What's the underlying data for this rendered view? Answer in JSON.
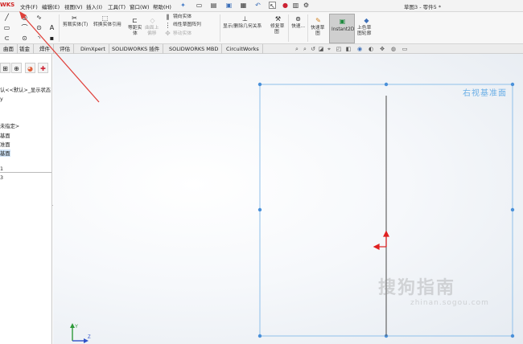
{
  "app": {
    "logo": "WKS",
    "doc_title": "草图3 - 零件5 *"
  },
  "menu": [
    "文件(F)",
    "编辑(E)",
    "视图(V)",
    "插入(I)",
    "工具(T)",
    "窗口(W)",
    "帮助(H)"
  ],
  "ribbon": {
    "trim": "剪裁实体(T)",
    "convert": "转换实体引用",
    "offset_line1": "等距实",
    "offset_line2": "体",
    "surface_line1": "曲面上",
    "surface_line2": "偏移",
    "mirror": "镜向实体",
    "linear_pattern": "线性草图阵列",
    "move": "移动实体",
    "relations": "显示/删除几何关系",
    "repair_line1": "修复草",
    "repair_line2": "图",
    "quick_snap": "快速...",
    "rapid_sketch_line1": "快速草",
    "rapid_sketch_line2": "图",
    "instant2d": "Instant2D",
    "shaded_line1": "上色草",
    "shaded_line2": "图轮廓"
  },
  "tabs": [
    "曲面",
    "钣金",
    "焊件",
    "评估",
    "DimXpert",
    "SOLIDWORKS 插件",
    "SOLIDWORKS MBD",
    "CircuitWorks"
  ],
  "tree": {
    "config": "认<<默认>_显示状态",
    "row2": "y",
    "unassigned": "未指定>",
    "plane1": "基面",
    "plane2": "准面",
    "plane3": "基面",
    "item_1": "1",
    "item_3": "3"
  },
  "viewport": {
    "plane_label": "右视基准面",
    "watermark_cn": "搜狗指南",
    "watermark_url": "zhinan.sogou.com",
    "triad_y": "Y",
    "triad_z": "Z"
  },
  "colors": {
    "accent": "#6aaee6",
    "annotation": "#e0403a",
    "origin": "#e02020"
  }
}
